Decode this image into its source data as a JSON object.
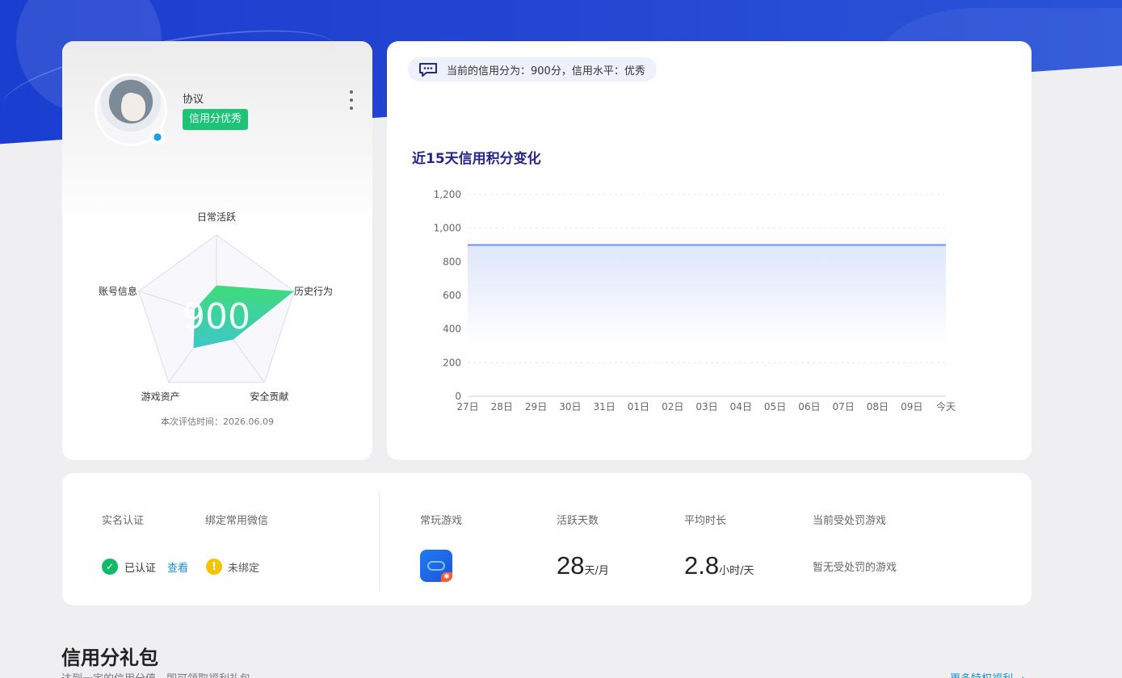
{
  "profile": {
    "username": "协议",
    "credit_badge": "信用分优秀",
    "qq_icon": "qq-penguin-icon",
    "radar": {
      "center_score": "900",
      "axes": [
        "日常活跃",
        "历史行为",
        "安全贡献",
        "游戏资产",
        "账号信息"
      ],
      "values": [
        0.38,
        1.0,
        0.35,
        0.48,
        0.28
      ],
      "fill_colors": [
        "#3fdb7a",
        "#3ec7c8"
      ]
    },
    "eval_time": "本次评估时间：2026.06.09"
  },
  "chart": {
    "score_text": "当前的信用分为：900分，信用水平：优秀",
    "title": "近15天信用积分变化"
  },
  "chart_data": {
    "type": "area",
    "categories": [
      "27日",
      "28日",
      "29日",
      "30日",
      "31日",
      "01日",
      "02日",
      "03日",
      "04日",
      "05日",
      "06日",
      "07日",
      "08日",
      "09日",
      "今天"
    ],
    "values": [
      900,
      900,
      900,
      900,
      900,
      900,
      900,
      900,
      900,
      900,
      900,
      900,
      900,
      900,
      900
    ],
    "y_ticks": [
      "0",
      "200",
      "400",
      "600",
      "800",
      "1,000",
      "1,200"
    ],
    "ylim": [
      0,
      1200
    ],
    "grid": "dashed horizontal",
    "line_color": "#6a93f0",
    "fill_color": "#dfe6fb"
  },
  "stats": {
    "realname_label": "实名认证",
    "wechat_label": "绑定常用微信",
    "verified_text": "已认证",
    "view_link": "查看",
    "unbound_text": "未绑定",
    "games_label": "常玩游戏",
    "active_days_label": "活跃天数",
    "active_days_value": "28",
    "active_days_unit": "天/月",
    "avg_time_label": "平均时长",
    "avg_time_value": "2.8",
    "avg_time_unit": "小时/天",
    "penalty_label": "当前受处罚游戏",
    "penalty_text": "暂无受处罚的游戏"
  },
  "gift": {
    "title": "信用分礼包",
    "subtitle": "达到一定的信用分值，即可领取福利礼包",
    "more_link": "更多特权福利 →"
  }
}
